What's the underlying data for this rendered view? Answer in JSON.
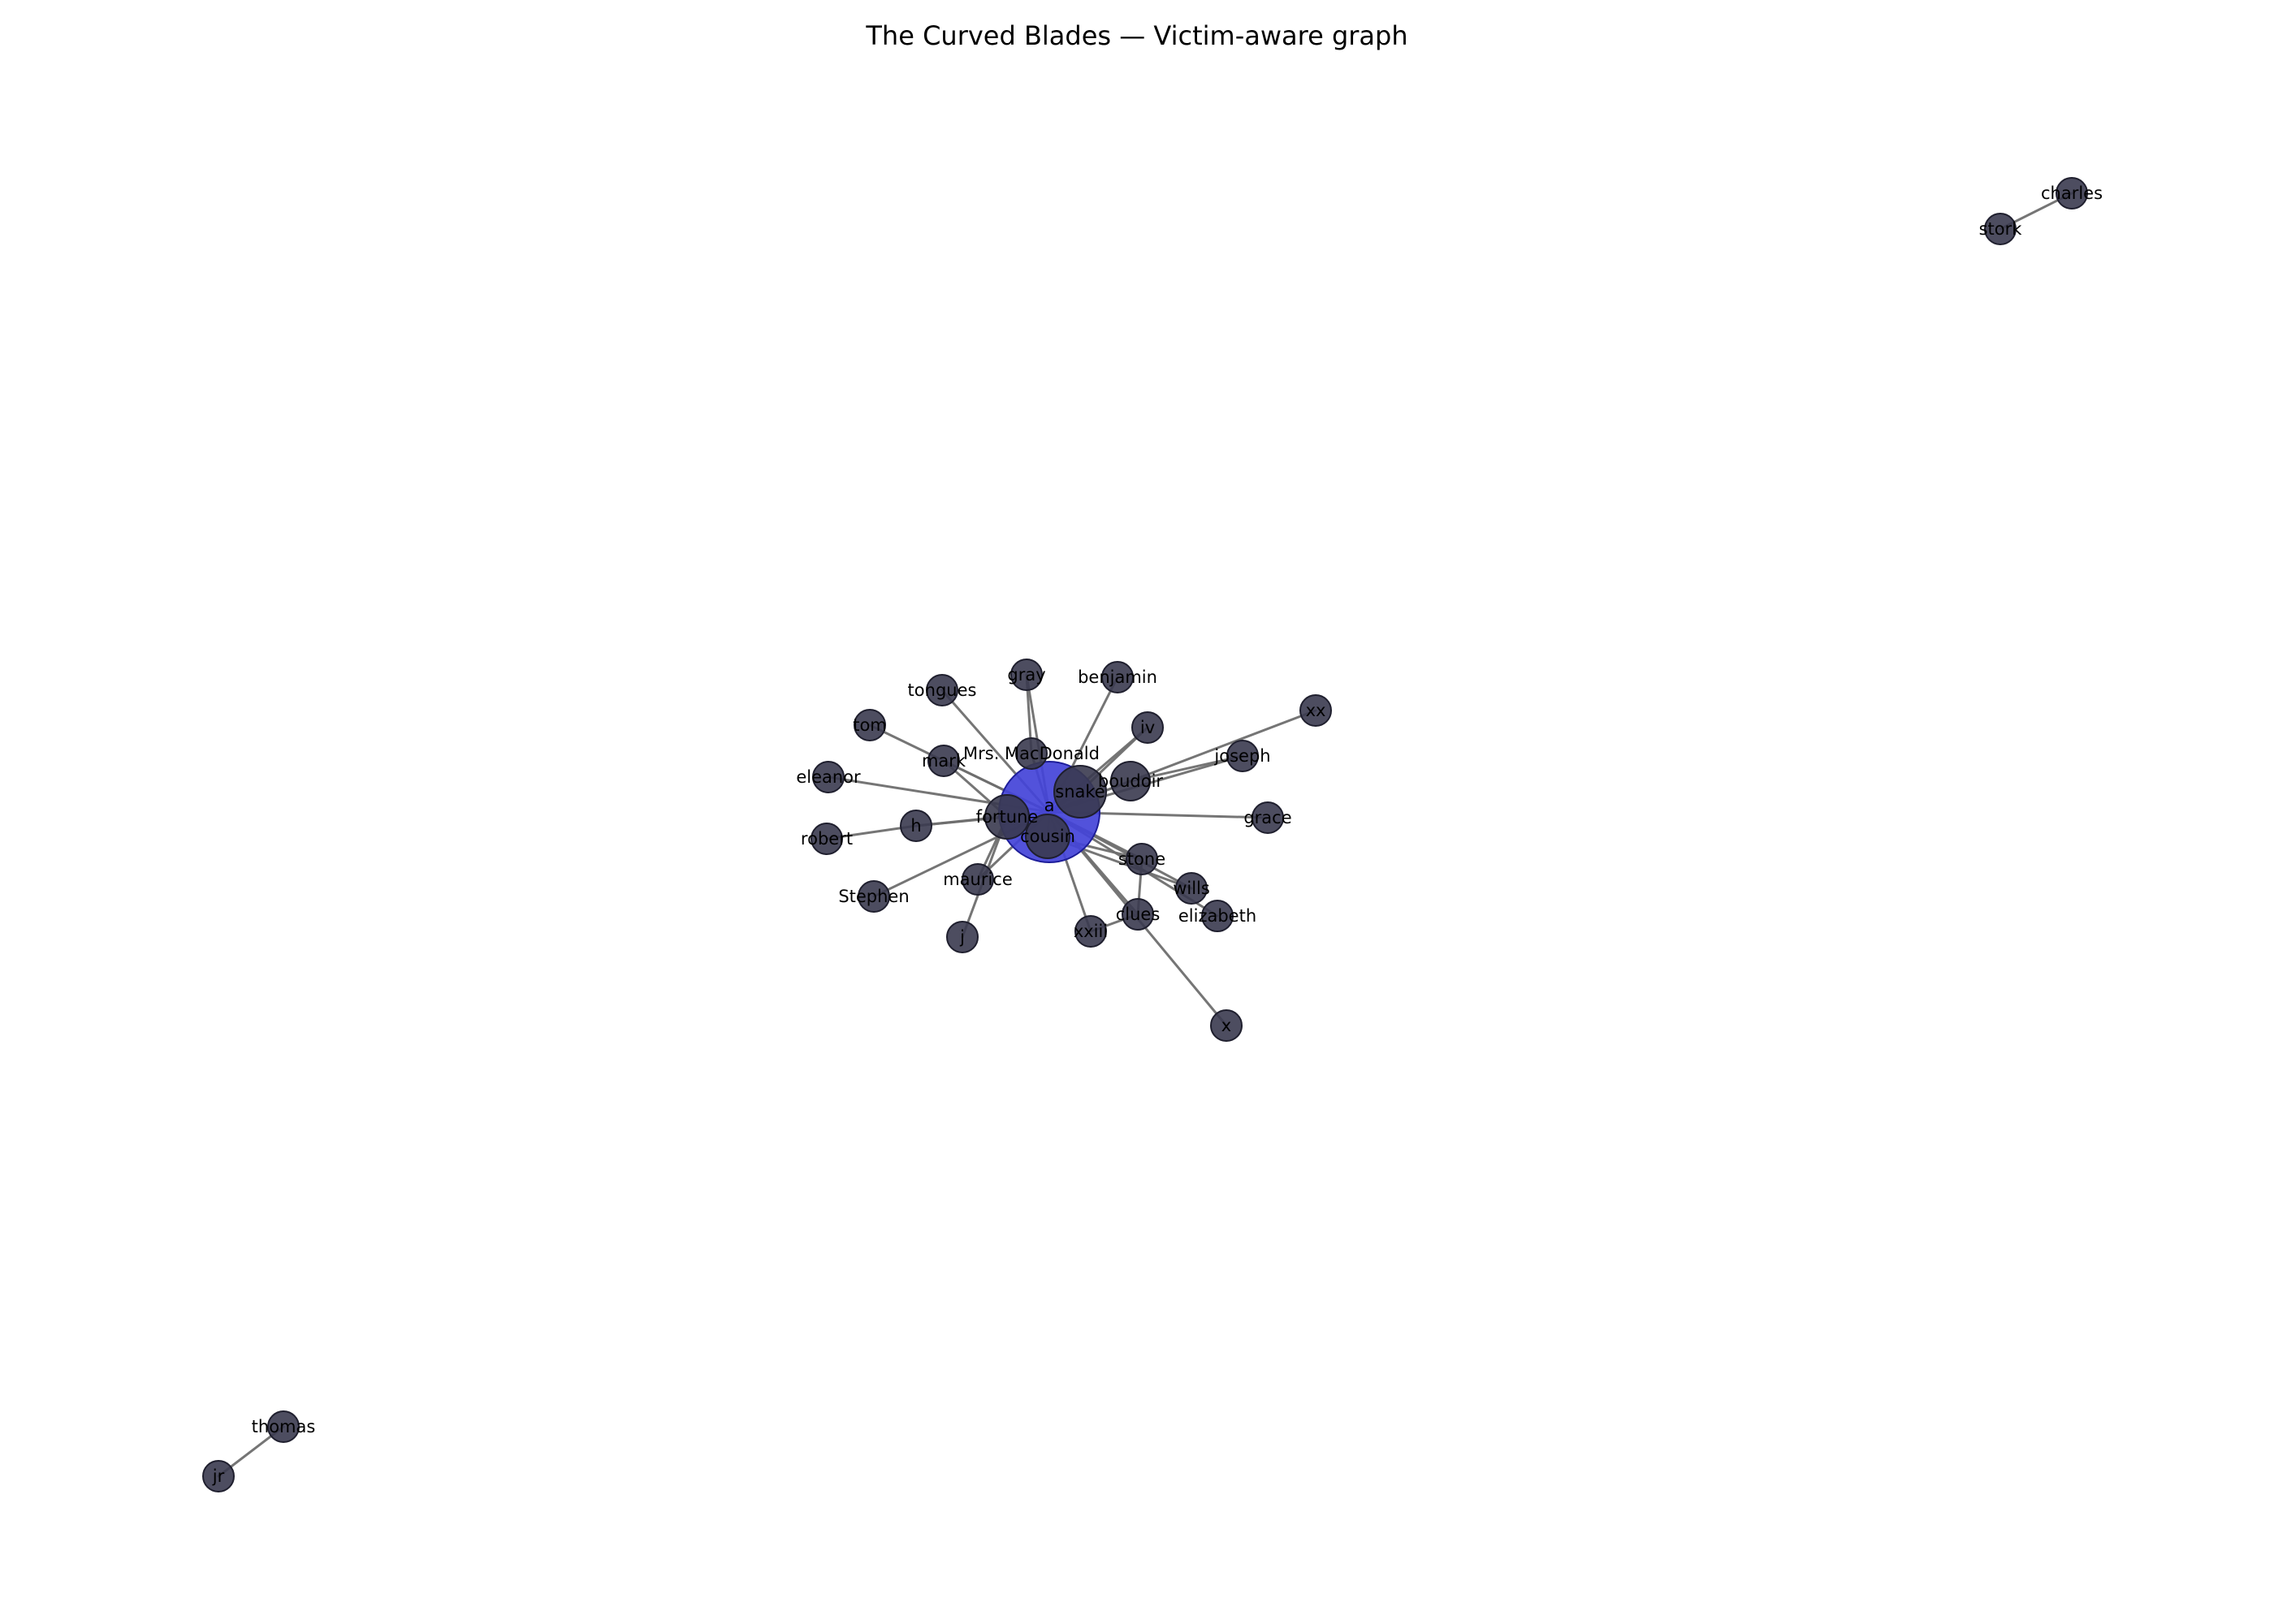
{
  "title": "The Curved Blades — Victim-aware graph",
  "colors": {
    "background": "#ffffff",
    "node_fill": "#3a3a4f",
    "node_stroke": "#1f1f2e",
    "victim_fill": "#4343d8",
    "victim_stroke": "#1e1e9a",
    "edge": "#6e6e6e"
  },
  "nodes": [
    {
      "id": "a",
      "label": "a",
      "role": "victim"
    },
    {
      "id": "cousin",
      "label": "cousin"
    },
    {
      "id": "fortune",
      "label": "fortune"
    },
    {
      "id": "snake",
      "label": "snake"
    },
    {
      "id": "boudoir",
      "label": "boudoir"
    },
    {
      "id": "mrs-macdonald",
      "label": "Mrs. MacDonald"
    },
    {
      "id": "mark",
      "label": "mark"
    },
    {
      "id": "tongues",
      "label": "tongues"
    },
    {
      "id": "gray",
      "label": "gray"
    },
    {
      "id": "benjamin",
      "label": "benjamin"
    },
    {
      "id": "iv",
      "label": "iv"
    },
    {
      "id": "xx",
      "label": "xx"
    },
    {
      "id": "joseph",
      "label": "joseph"
    },
    {
      "id": "tom",
      "label": "tom"
    },
    {
      "id": "eleanor",
      "label": "eleanor"
    },
    {
      "id": "h",
      "label": "h"
    },
    {
      "id": "robert",
      "label": "robert"
    },
    {
      "id": "stephen",
      "label": "Stephen"
    },
    {
      "id": "maurice",
      "label": "maurice"
    },
    {
      "id": "j",
      "label": "j"
    },
    {
      "id": "xxiii",
      "label": "xxiii"
    },
    {
      "id": "clues",
      "label": "clues"
    },
    {
      "id": "stone",
      "label": "stone"
    },
    {
      "id": "wills",
      "label": "wills"
    },
    {
      "id": "elizabeth",
      "label": "elizabeth"
    },
    {
      "id": "grace",
      "label": "grace"
    },
    {
      "id": "x",
      "label": "x"
    },
    {
      "id": "charles",
      "label": "charles"
    },
    {
      "id": "stork",
      "label": "stork"
    },
    {
      "id": "thomas",
      "label": "thomas"
    },
    {
      "id": "jr",
      "label": "jr"
    }
  ],
  "edges": [
    [
      "a",
      "cousin"
    ],
    [
      "a",
      "fortune"
    ],
    [
      "a",
      "snake"
    ],
    [
      "a",
      "boudoir"
    ],
    [
      "a",
      "mrs-macdonald"
    ],
    [
      "a",
      "mark"
    ],
    [
      "a",
      "tongues"
    ],
    [
      "a",
      "gray"
    ],
    [
      "a",
      "benjamin"
    ],
    [
      "a",
      "iv"
    ],
    [
      "a",
      "xx"
    ],
    [
      "a",
      "joseph"
    ],
    [
      "a",
      "tom"
    ],
    [
      "a",
      "eleanor"
    ],
    [
      "a",
      "h"
    ],
    [
      "a",
      "stephen"
    ],
    [
      "a",
      "maurice"
    ],
    [
      "a",
      "xxiii"
    ],
    [
      "a",
      "clues"
    ],
    [
      "a",
      "stone"
    ],
    [
      "a",
      "wills"
    ],
    [
      "a",
      "elizabeth"
    ],
    [
      "a",
      "grace"
    ],
    [
      "a",
      "x"
    ],
    [
      "fortune",
      "h"
    ],
    [
      "fortune",
      "mark"
    ],
    [
      "fortune",
      "j"
    ],
    [
      "fortune",
      "maurice"
    ],
    [
      "cousin",
      "stone"
    ],
    [
      "cousin",
      "wills"
    ],
    [
      "snake",
      "iv"
    ],
    [
      "boudoir",
      "joseph"
    ],
    [
      "mrs-macdonald",
      "gray"
    ],
    [
      "h",
      "robert"
    ],
    [
      "stone",
      "clues"
    ],
    [
      "clues",
      "xxiii"
    ],
    [
      "charles",
      "stork"
    ],
    [
      "thomas",
      "jr"
    ]
  ]
}
